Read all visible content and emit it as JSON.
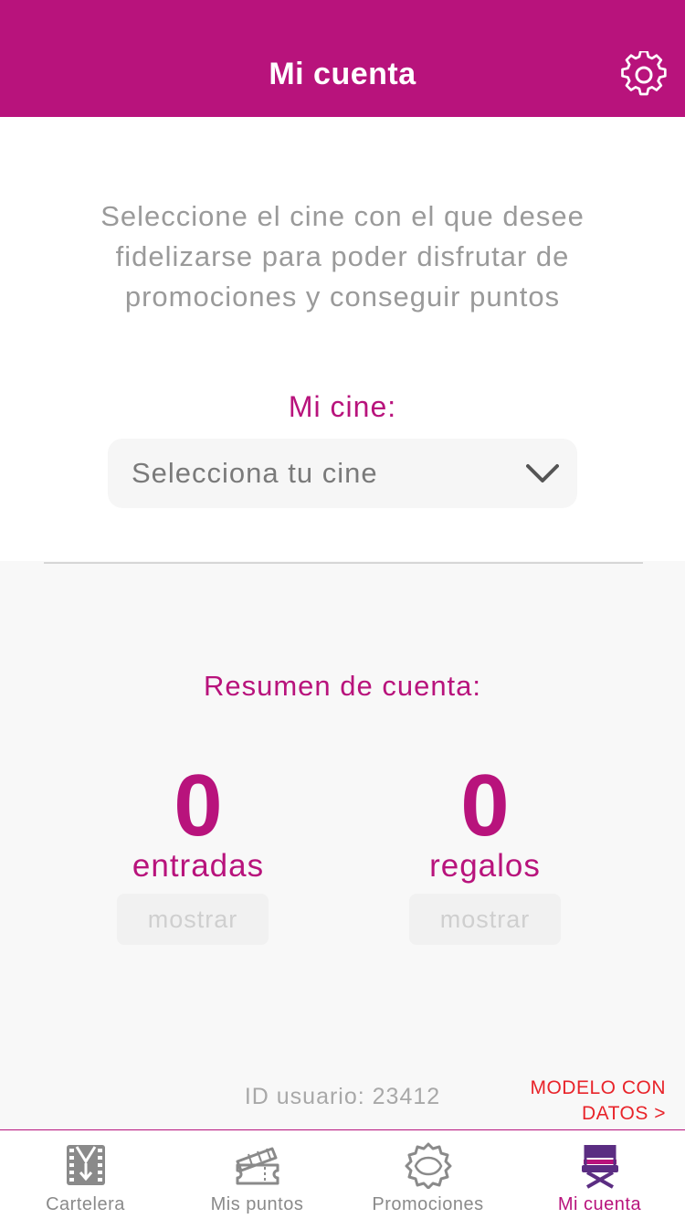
{
  "header": {
    "title": "Mi cuenta",
    "settings_icon": "gear-icon",
    "background_color": "#b8137c"
  },
  "intro": {
    "text": "Seleccione el cine con el que desee fidelizarse para poder disfrutar de promociones y conseguir puntos"
  },
  "cinema": {
    "label": "Mi cine:",
    "select_value": "Selecciona tu cine",
    "select_icon": "chevron-down-icon"
  },
  "summary": {
    "title": "Resumen de cuenta:",
    "tickets": {
      "count": "0",
      "label": "entradas",
      "button": "mostrar"
    },
    "gifts": {
      "count": "0",
      "label": "regalos",
      "button": "mostrar"
    }
  },
  "footer": {
    "user_id": "ID usuario: 23412",
    "modelo_line1": "MODELO CON",
    "modelo_line2": "DATOS >"
  },
  "tabs": [
    {
      "label": "Cartelera",
      "icon": "film-icon",
      "active": false
    },
    {
      "label": "Mis puntos",
      "icon": "ticket-icon",
      "active": false
    },
    {
      "label": "Promociones",
      "icon": "badge-icon",
      "active": false
    },
    {
      "label": "Mi cuenta",
      "icon": "director-chair-icon",
      "active": true
    }
  ],
  "colors": {
    "accent": "#b8137c",
    "link_red": "#e8242a",
    "muted_text": "#9a9a9a"
  }
}
